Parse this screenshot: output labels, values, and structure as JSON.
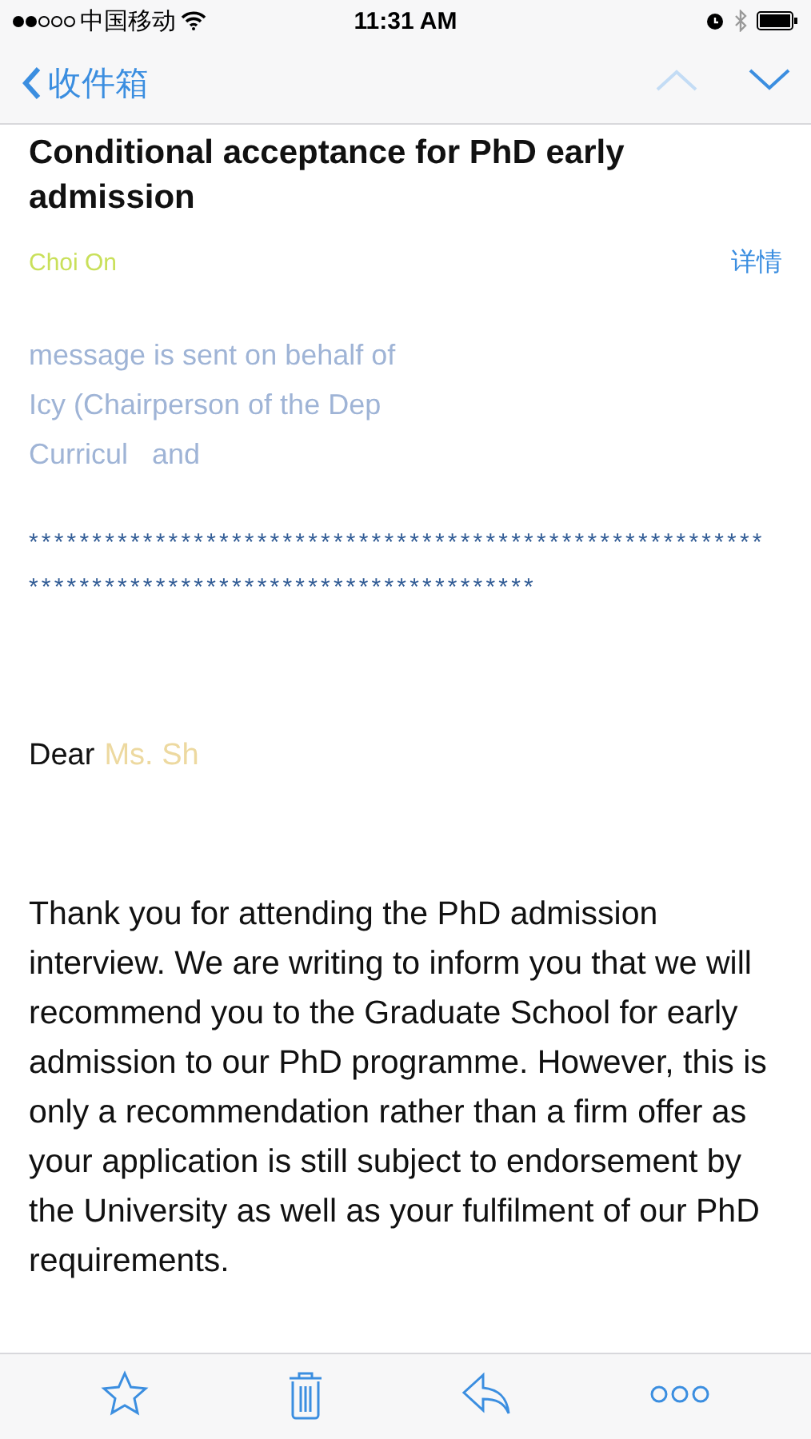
{
  "status_bar": {
    "carrier": "中国移动",
    "time": "11:31 AM"
  },
  "nav": {
    "back_label": "收件箱",
    "prev_enabled": false,
    "next_enabled": true
  },
  "subject": "Conditional acceptance for PhD early admission",
  "sender": {
    "name": "Choi On",
    "details_link": "详情"
  },
  "body": [
    {
      "kind": "faded",
      "lines": [
        "message is sent on behalf of",
        "Icy (Chairperson of the Dep",
        "Curricul   and"
      ]
    },
    {
      "kind": "stars",
      "lines": [
        "**********************************************************",
        "****************************************"
      ]
    },
    {
      "kind": "greeting",
      "text": "Dear",
      "faded": "Ms. Sh"
    },
    {
      "kind": "paragraph",
      "text": "Thank you for attending the PhD admission interview. We are writing to inform you that we will recommend you to the Graduate School for early admission to our PhD programme. However, this is only a recommendation rather than a firm offer as your application is still subject to endorsement by the University as well as your fulfilment of our PhD requirements."
    }
  ]
}
